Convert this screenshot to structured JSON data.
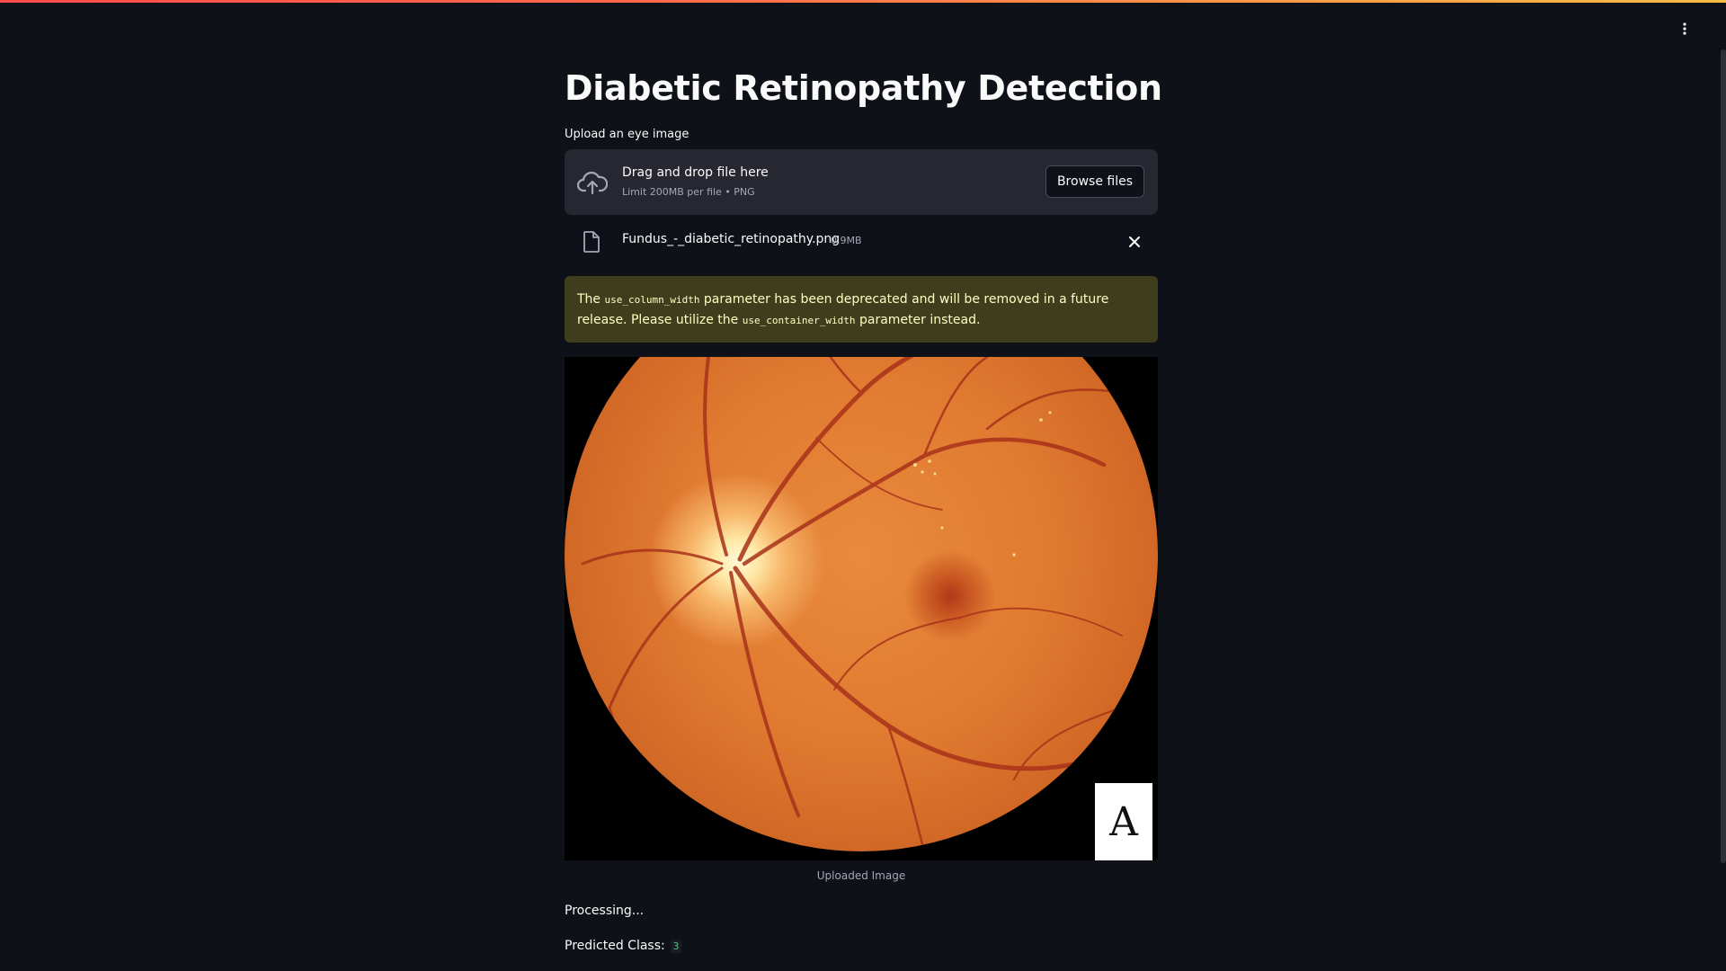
{
  "app": {
    "title": "Diabetic Retinopathy Detection",
    "accent_gradient": [
      "#ff4b4b",
      "#ffbd45"
    ],
    "menu_icon": "kebab-menu-icon"
  },
  "uploader": {
    "label": "Upload an eye image",
    "drop_title": "Drag and drop file here",
    "drop_subtitle": "Limit 200MB per file • PNG",
    "browse_label": "Browse files",
    "cloud_icon": "cloud-upload-icon"
  },
  "uploaded_file": {
    "name": "Fundus_-_diabetic_retinopathy.png",
    "size": "0.9MB",
    "file_icon": "file-icon",
    "remove_icon": "close-icon"
  },
  "warning": {
    "prefix": "The ",
    "code1": "use_column_width",
    "middle": " parameter has been deprecated and will be removed in a future release. Please utilize the ",
    "code2": "use_container_width",
    "suffix": " parameter instead.",
    "background": "#3e3e1f",
    "text_color": "#ffffc2"
  },
  "image": {
    "caption": "Uploaded Image",
    "logo_letter": "A"
  },
  "status": {
    "processing": "Processing...",
    "predicted_label": "Predicted Class:",
    "predicted_value": "3",
    "predicted_color": "#3dd56d"
  }
}
